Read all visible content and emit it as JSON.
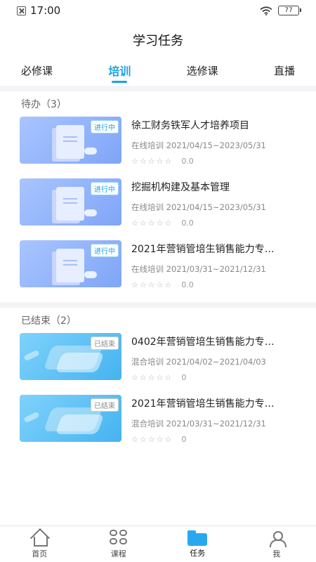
{
  "status_bar": {
    "time": "17:00",
    "battery": "77"
  },
  "header": {
    "title": "学习任务"
  },
  "tabs": [
    {
      "label": "必修课",
      "active": false
    },
    {
      "label": "培训",
      "active": true
    },
    {
      "label": "选修课",
      "active": false
    },
    {
      "label": "直播",
      "active": false
    }
  ],
  "sections": [
    {
      "title": "待办（3）",
      "items": [
        {
          "title": "徐工财务铁军人才培养项目",
          "meta": "在线培训 2021/04/15~2023/05/31",
          "stars": "☆☆☆☆☆",
          "score": "0.0",
          "badge": "进行中",
          "theme": "blue"
        },
        {
          "title": "挖掘机构建及基本管理",
          "meta": "在线培训 2021/04/15~2023/05/31",
          "stars": "☆☆☆☆☆",
          "score": "0.0",
          "badge": "进行中",
          "theme": "blue"
        },
        {
          "title": "2021年营销管培生销售能力专…",
          "meta": "在线培训 2021/03/31~2021/12/31",
          "stars": "☆☆☆☆☆",
          "score": "0.0",
          "badge": "进行中",
          "theme": "blue"
        }
      ]
    },
    {
      "title": "已结束（2）",
      "items": [
        {
          "title": "0402年营销管培生销售能力专…",
          "meta": "混合培训 2021/04/02~2021/04/03",
          "stars": "☆☆☆☆☆",
          "score": "0",
          "badge": "已结束",
          "theme": "cyan"
        },
        {
          "title": "2021年营销管培生销售能力专…",
          "meta": "混合培训 2021/03/31~2021/12/31",
          "stars": "☆☆☆☆☆",
          "score": "0",
          "badge": "已结束",
          "theme": "cyan"
        }
      ]
    }
  ],
  "bottom_nav": [
    {
      "label": "首页",
      "icon": "home-icon",
      "active": false
    },
    {
      "label": "课程",
      "icon": "grid-icon",
      "active": false
    },
    {
      "label": "任务",
      "icon": "folder-icon",
      "active": true
    },
    {
      "label": "我",
      "icon": "me-icon",
      "active": false
    }
  ],
  "colors": {
    "accent": "#1aa3e8",
    "thumb_blue": "#8fb1fa",
    "thumb_cyan": "#5cc1f4"
  }
}
